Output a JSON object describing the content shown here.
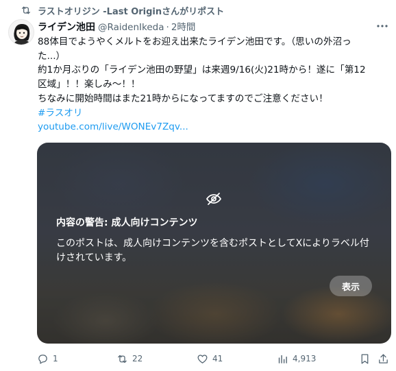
{
  "repost": {
    "icon": "retweet-icon",
    "text": "ラストオリジン -Last Originさんがリポスト"
  },
  "author": {
    "name": "ライデン池田",
    "handle": "@RaidenIkeda",
    "separator": "·",
    "time": "2時間",
    "avatar_icon": "avatar-icon"
  },
  "more_icon": "more-options-icon",
  "body": {
    "lines": [
      "88体目でようやくメルトをお迎え出来たライデン池田です。（思いの外沼っ",
      "た...）",
      "約1か月ぶりの「ライデン池田の野望」は来週9/16(火)21時から！遂に「第12",
      "区域」！！楽しみ～！！",
      "ちなみに開始時間はまた21時からになってますのでご注意ください！"
    ],
    "hashtag": "#ラスオリ",
    "link": "youtube.com/live/WONEv7Zqv..."
  },
  "media_warning": {
    "icon": "eye-slash-icon",
    "title": "内容の警告: 成人向けコンテンツ",
    "description": "このポストは、成人向けコンテンツを含むポストとしてXによりラベル付けされています。",
    "show_button": "表示"
  },
  "actions": {
    "reply": {
      "icon": "reply-icon",
      "count": "1"
    },
    "repost": {
      "icon": "retweet-icon",
      "count": "22"
    },
    "like": {
      "icon": "heart-icon",
      "count": "41"
    },
    "views": {
      "icon": "views-chart-icon",
      "count": "4,913"
    },
    "bookmark": {
      "icon": "bookmark-icon"
    },
    "share": {
      "icon": "share-icon"
    }
  },
  "colors": {
    "link": "#1d9bf0",
    "secondary_text": "#536471",
    "primary_text": "#0f1419"
  }
}
